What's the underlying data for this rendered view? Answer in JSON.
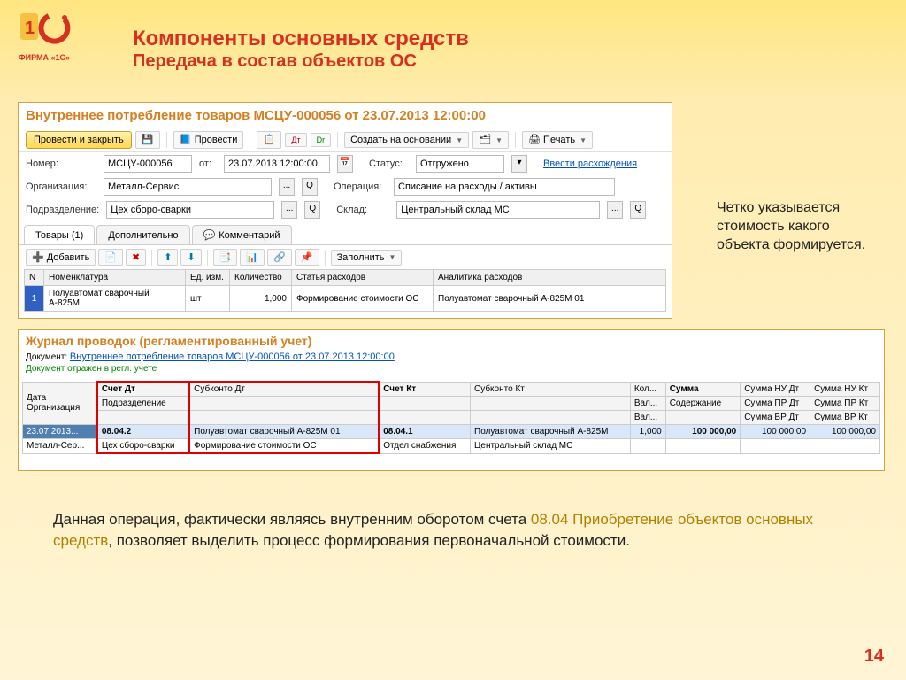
{
  "logo_text": "ФИРМА «1С»",
  "header": {
    "title": "Компоненты основных средств",
    "sub": "Передача в состав объектов ОС"
  },
  "doc": {
    "title": "Внутреннее потребление товаров МСЦУ-000056 от 23.07.2013 12:00:00",
    "btn_post_close": "Провести и закрыть",
    "btn_post": "Провести",
    "btn_create_base": "Создать на основании",
    "btn_print": "Печать",
    "lbl_number": "Номер:",
    "number": "МСЦУ-000056",
    "lbl_from": "от:",
    "date": "23.07.2013 12:00:00",
    "lbl_status": "Статус:",
    "status": "Отгружено",
    "link_discr": "Ввести расхождения",
    "lbl_org": "Организация:",
    "org": "Металл-Сервис",
    "lbl_oper": "Операция:",
    "oper": "Списание на расходы / активы",
    "lbl_subdiv": "Подразделение:",
    "subdiv": "Цех сборо-сварки",
    "lbl_warehouse": "Склад:",
    "warehouse": "Центральный склад МС",
    "tab_goods": "Товары (1)",
    "tab_addl": "Дополнительно",
    "tab_comment": "Комментарий",
    "btn_add": "Добавить",
    "btn_fill": "Заполнить",
    "col_n": "N",
    "col_nom": "Номенклатура",
    "col_unit": "Ед. изм.",
    "col_qty": "Количество",
    "col_expitem": "Статья расходов",
    "col_analytic": "Аналитика расходов",
    "row": {
      "n": "1",
      "nom": "Полуавтомат сварочный А-825М",
      "unit": "шт",
      "qty": "1,000",
      "expitem": "Формирование стоимости ОС",
      "analytic": "Полуавтомат сварочный А-825М   01"
    }
  },
  "journal": {
    "title": "Журнал проводок (регламентированный учет)",
    "lbl_doc": "Документ:",
    "doc_link": "Внутреннее потребление товаров МСЦУ-000056 от 23.07.2013 12:00:00",
    "status_text": "Документ отражен в регл. учете",
    "h": {
      "date": "Дата",
      "org": "Организация",
      "dt": "Счет Дт",
      "sub_dt": "Субконто Дт",
      "subdiv": "Подразделение",
      "kt": "Счет Кт",
      "sub_kt": "Субконто Кт",
      "qty": "Кол...",
      "cur": "Вал...",
      "sum": "Сумма",
      "content": "Содержание",
      "nu_dt": "Сумма НУ Дт",
      "pr_dt": "Сумма ПР Дт",
      "vr_dt": "Сумма ВР Дт",
      "nu_kt": "Сумма НУ Кт",
      "pr_kt": "Сумма ПР Кт",
      "vr_kt": "Сумма ВР Кт"
    },
    "r": {
      "date": "23.07.2013...",
      "org": "Металл-Сер...",
      "dt": "08.04.2",
      "sub_dt": "Полуавтомат сварочный А-825М   01",
      "subdiv": "Цех сборо-сварки",
      "sub_dt2": "Формирование стоимости ОС",
      "kt": "08.04.1",
      "sub_kt": "Полуавтомат сварочный А-825М",
      "kt_dept": "Отдел снабжения",
      "sub_kt2": "Центральный склад МС",
      "qty": "1,000",
      "sum": "100 000,00",
      "nu_dt": "100 000,00",
      "nu_kt": "100 000,00"
    }
  },
  "note_right": "Четко указывается стоимость какого объекта формируется.",
  "note_bottom": {
    "p1": "Данная операция, фактически являясь внутренним оборотом счета ",
    "acc": "08.04 Приобретение объектов основных средств",
    "p2": ", позволяет выделить процесс формирования первоначальной стоимости."
  },
  "pagenum": "14"
}
